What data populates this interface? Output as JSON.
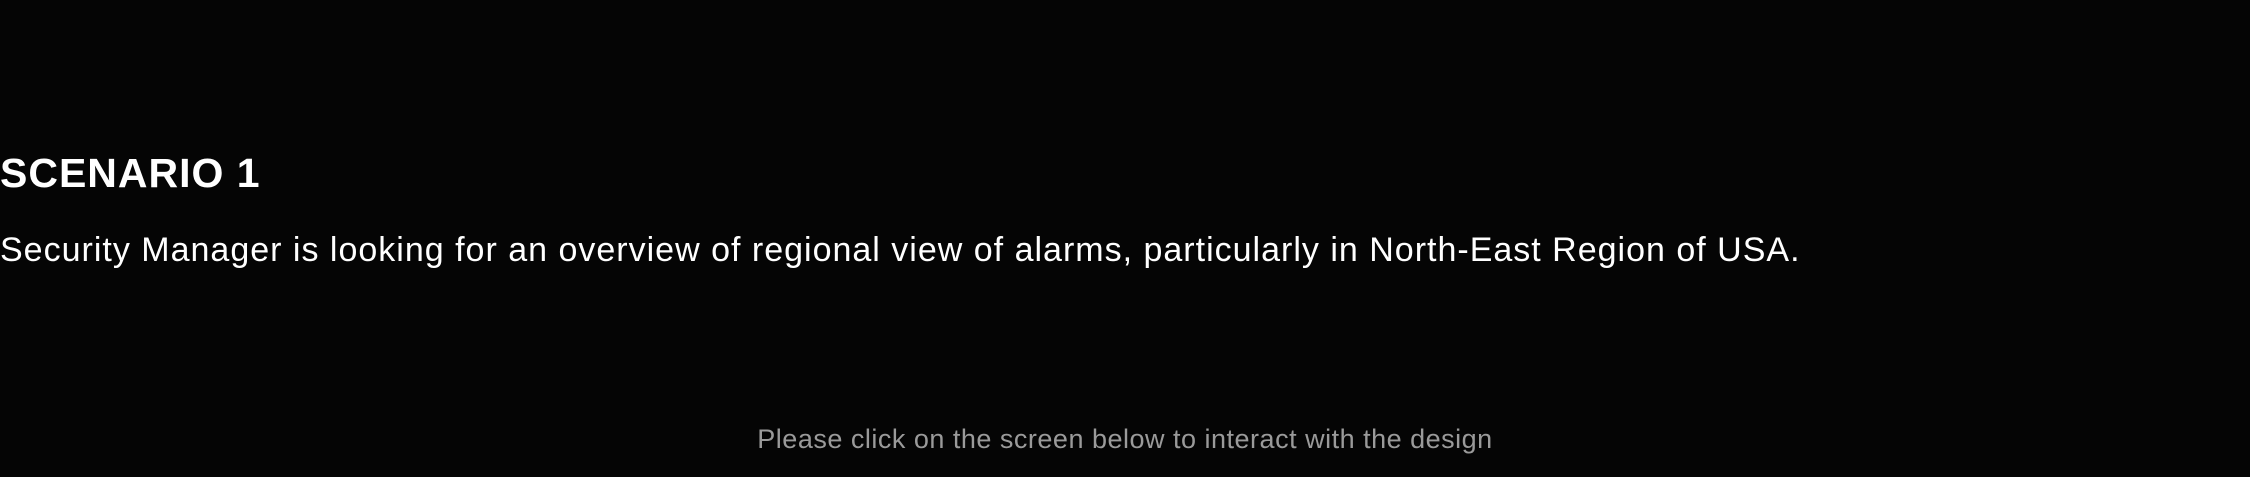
{
  "scenario": {
    "title": "SCENARIO 1",
    "description": "Security Manager is looking for an overview of regional view of alarms, particularly in North-East Region of USA."
  },
  "hint": {
    "text": "Please click on the screen below to interact with the design"
  },
  "colors": {
    "background": "#050505",
    "text": "#ffffff",
    "hint_text": "#9a9a9a"
  }
}
